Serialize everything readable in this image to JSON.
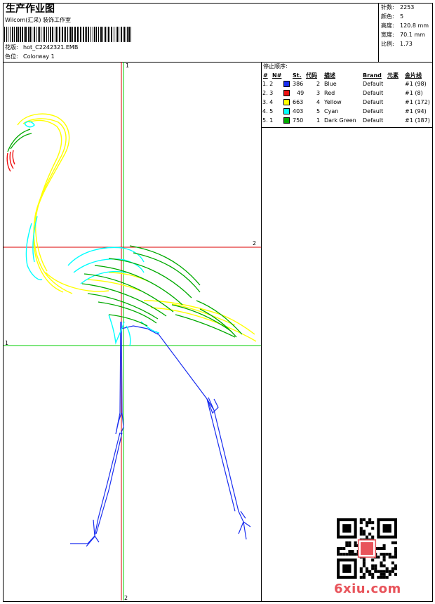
{
  "header": {
    "title": "生产作业图",
    "company": "Wilcom(汇采) 装饰工作室",
    "design_label": "花版:",
    "design_name": "hot_C2242321.EMB",
    "colorway_label": "色位:",
    "colorway_name": "Colorway 1"
  },
  "stats": {
    "stitches_label": "针数:",
    "stitches": "2253",
    "colors_label": "颜色:",
    "colors": "5",
    "height_label": "高度:",
    "height": "120.8 mm",
    "width_label": "宽度:",
    "width": "70.1 mm",
    "scale_label": "比例:",
    "scale": "1.73"
  },
  "stop_sequence": {
    "title": "停止顺序:",
    "headers": {
      "idx": "#",
      "n": "N#",
      "st": "St.",
      "code": "代码",
      "desc": "描述",
      "brand": "Brand",
      "elem": "元素",
      "chart": "金片线"
    },
    "rows": [
      {
        "idx": "1. 2",
        "color": "#1a2ef0",
        "st": "386",
        "code": "2",
        "desc": "Blue",
        "brand": "Default",
        "chart": "#1 (98)"
      },
      {
        "idx": "2. 3",
        "color": "#ee1111",
        "st": "49",
        "code": "3",
        "desc": "Red",
        "brand": "Default",
        "chart": "#1 (8)"
      },
      {
        "idx": "3. 4",
        "color": "#ffff00",
        "st": "663",
        "code": "4",
        "desc": "Yellow",
        "brand": "Default",
        "chart": "#1 (172)"
      },
      {
        "idx": "4. 5",
        "color": "#00ffff",
        "st": "403",
        "code": "5",
        "desc": "Cyan",
        "brand": "Default",
        "chart": "#1 (94)"
      },
      {
        "idx": "5. 1",
        "color": "#00aa00",
        "st": "750",
        "code": "1",
        "desc": "Dark Green",
        "brand": "Default",
        "chart": "#1 (187)"
      }
    ]
  },
  "guides": {
    "v_top": "1",
    "v_bottom": "2",
    "h_red": "2",
    "h_green": "1"
  },
  "colors": {
    "blue": "#1a2ef0",
    "red": "#ee1111",
    "yellow": "#ffff00",
    "cyan": "#00ffff",
    "green": "#00aa00",
    "guide_red": "#dd0000",
    "guide_green": "#00cc00"
  },
  "watermark": {
    "site": "6xiu.com"
  }
}
